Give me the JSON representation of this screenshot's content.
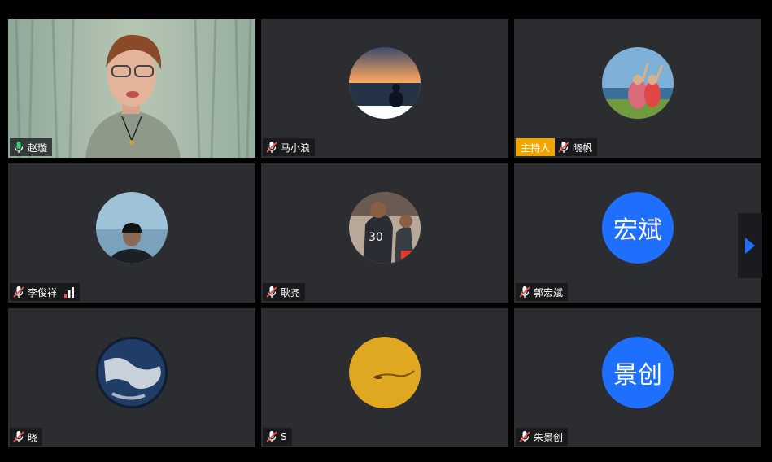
{
  "participants": [
    {
      "name": "赵璇",
      "muted": false,
      "host": false,
      "avatar": "video-feed"
    },
    {
      "name": "马小浪",
      "muted": true,
      "host": false,
      "avatar": "sunset-sea-photo"
    },
    {
      "name": "晓帆",
      "muted": true,
      "host": true,
      "avatar": "beach-couple-photo"
    },
    {
      "name": "李俊祥",
      "muted": true,
      "host": false,
      "avatar": "sea-back-photo",
      "signal": true
    },
    {
      "name": "耿尧",
      "muted": true,
      "host": false,
      "avatar": "basketball-photo"
    },
    {
      "name": "郭宏斌",
      "muted": true,
      "host": false,
      "avatar_text": "宏斌"
    },
    {
      "name": "晓",
      "muted": true,
      "host": false,
      "avatar": "earth-photo"
    },
    {
      "name": "S",
      "muted": true,
      "host": false,
      "avatar": "yellow-sand-photo"
    },
    {
      "name": "朱景创",
      "muted": true,
      "host": false,
      "avatar_text": "景创"
    }
  ],
  "host_label": "主持人",
  "colors": {
    "host_badge": "#f0a500",
    "avatar_bg": "#1f6fff",
    "mic_on": "#2fd37b",
    "mic_off": "#ff4d4f",
    "nav_arrow": "#1f6fff"
  },
  "icons": {
    "mic": "microphone-icon",
    "mic_muted": "microphone-muted-icon",
    "signal": "signal-strength-icon",
    "next": "chevron-right-icon"
  }
}
